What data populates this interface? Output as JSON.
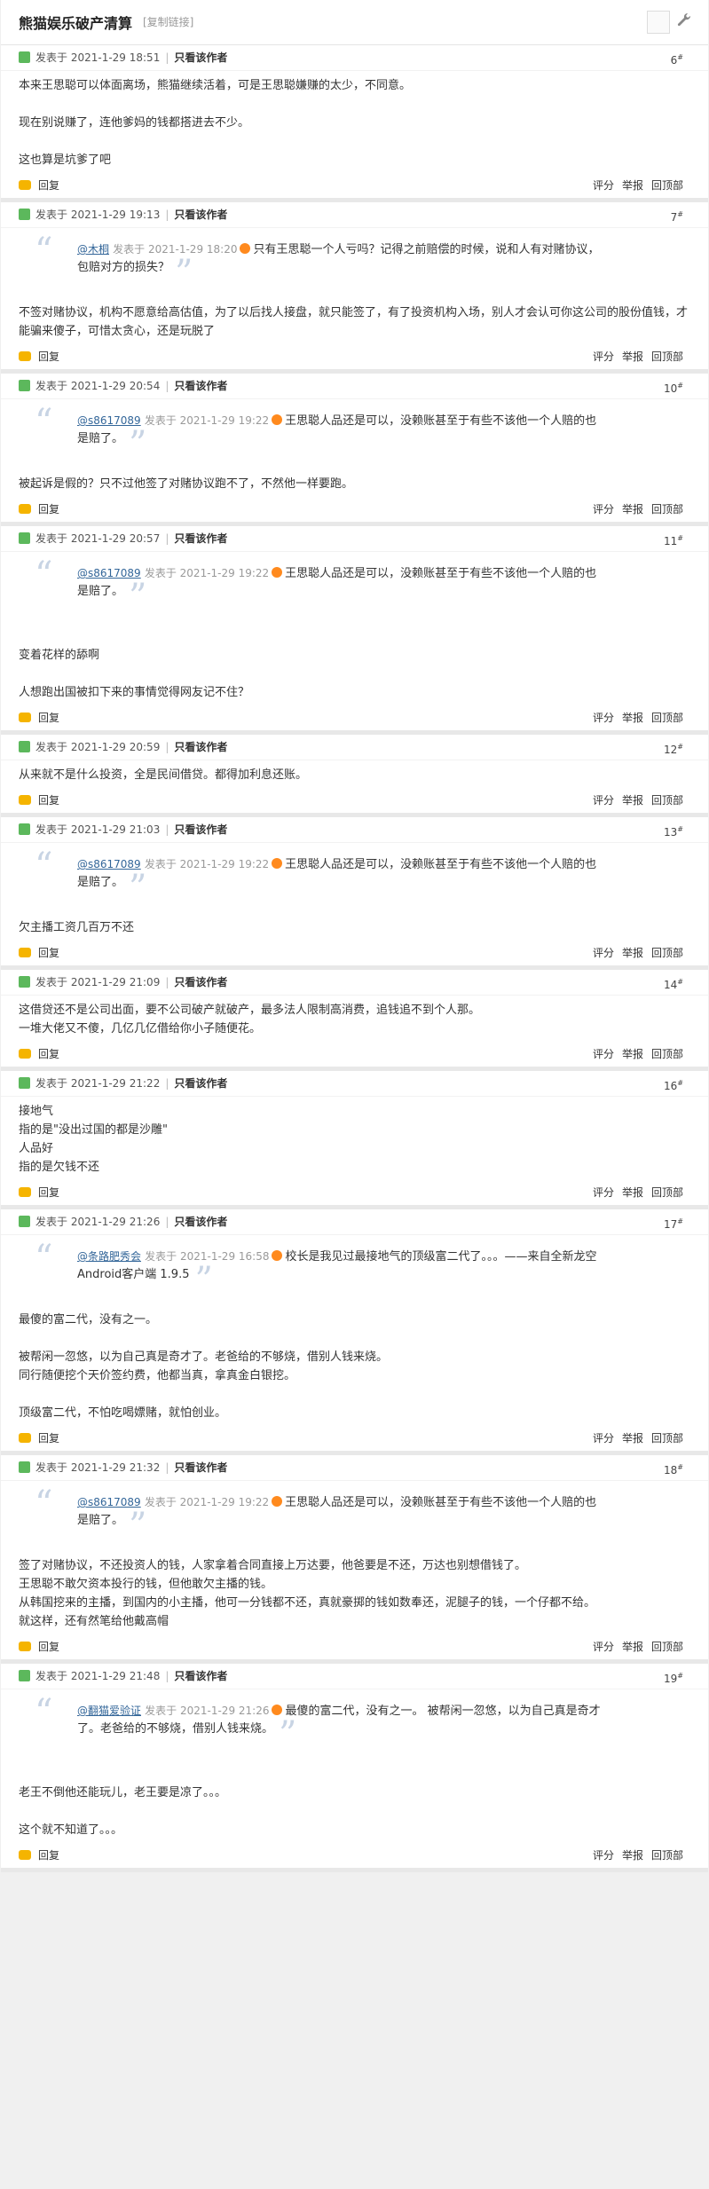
{
  "header": {
    "title": "熊猫娱乐破产清算",
    "copy_link": "[复制链接]",
    "wrench_icon": "wrench-icon"
  },
  "labels": {
    "posted_at": "发表于",
    "only_author": "只看该作者",
    "reply": "回复",
    "rate": "评分",
    "report": "举报",
    "back_top": "回顶部"
  },
  "posts": [
    {
      "floor": "6",
      "time": "2021-1-29 18:51",
      "lines": [
        "本来王思聪可以体面离场，熊猫继续活着，可是王思聪嫌赚的太少，不同意。",
        "",
        "现在别说赚了，连他爹妈的钱都搭进去不少。",
        "",
        "这也算是坑爹了吧"
      ]
    },
    {
      "floor": "7",
      "time": "2021-1-29 19:13",
      "quote": {
        "user": "@木桐",
        "when": "发表于 2021-1-29 18:20",
        "text": "只有王思聪一个人亏吗？记得之前赔偿的时候，说和人有对赌协议，包赔对方的损失？"
      },
      "lines": [
        "不签对赌协议，机构不愿意给高估值，为了以后找人接盘，就只能签了，有了投资机构入场，别人才会认可你这公司的股份值钱，才能骗来傻子，可惜太贪心，还是玩脱了"
      ]
    },
    {
      "floor": "10",
      "time": "2021-1-29 20:54",
      "quote": {
        "user": "@s8617089",
        "when": "发表于 2021-1-29 19:22",
        "text": "王思聪人品还是可以，没赖账甚至于有些不该他一个人赔的也是赔了。"
      },
      "lines": [
        "被起诉是假的？只不过他签了对赌协议跑不了，不然他一样要跑。"
      ]
    },
    {
      "floor": "11",
      "time": "2021-1-29 20:57",
      "quote": {
        "user": "@s8617089",
        "when": "发表于 2021-1-29 19:22",
        "text": "王思聪人品还是可以，没赖账甚至于有些不该他一个人赔的也是赔了。"
      },
      "lines": [
        "",
        "变着花样的舔啊",
        "",
        "人想跑出国被扣下来的事情觉得网友记不住？"
      ]
    },
    {
      "floor": "12",
      "time": "2021-1-29 20:59",
      "lines": [
        "从来就不是什么投资，全是民间借贷。都得加利息还账。"
      ]
    },
    {
      "floor": "13",
      "time": "2021-1-29 21:03",
      "quote": {
        "user": "@s8617089",
        "when": "发表于 2021-1-29 19:22",
        "text": "王思聪人品还是可以，没赖账甚至于有些不该他一个人赔的也是赔了。"
      },
      "lines": [
        "欠主播工资几百万不还"
      ]
    },
    {
      "floor": "14",
      "time": "2021-1-29 21:09",
      "lines": [
        "这借贷还不是公司出面，要不公司破产就破产，最多法人限制高消费，追钱追不到个人那。",
        "一堆大佬又不傻，几亿几亿借给你小子随便花。"
      ]
    },
    {
      "floor": "16",
      "time": "2021-1-29 21:22",
      "lines": [
        "接地气",
        "指的是\"没出过国的都是沙雕\"",
        "人品好",
        "指的是欠钱不还"
      ]
    },
    {
      "floor": "17",
      "time": "2021-1-29 21:26",
      "quote": {
        "user": "@条路肥秀会",
        "when": "发表于 2021-1-29 16:58",
        "text": "校长是我见过最接地气的顶级富二代了。。。——来自全新龙空Android客户端 1.9.5"
      },
      "lines": [
        "最傻的富二代，没有之一。",
        "",
        "被帮闲一忽悠，以为自己真是奇才了。老爸给的不够烧，借别人钱来烧。",
        "同行随便挖个天价签约费，他都当真，拿真金白银挖。",
        "",
        "顶级富二代，不怕吃喝嫖赌，就怕创业。"
      ]
    },
    {
      "floor": "18",
      "time": "2021-1-29 21:32",
      "quote": {
        "user": "@s8617089",
        "when": "发表于 2021-1-29 19:22",
        "text": "王思聪人品还是可以，没赖账甚至于有些不该他一个人赔的也是赔了。"
      },
      "lines": [
        "签了对赌协议，不还投资人的钱，人家拿着合同直接上万达要，他爸要是不还，万达也别想借钱了。",
        "王思聪不敢欠资本投行的钱，但他敢欠主播的钱。",
        "从韩国挖来的主播，到国内的小主播，他可一分钱都不还，真就豪掷的钱如数奉还，泥腿子的钱，一个仔都不给。",
        "就这样，还有然笔给他戴高帽"
      ]
    },
    {
      "floor": "19",
      "time": "2021-1-29 21:48",
      "quote": {
        "user": "@翻猫爱验证",
        "when": "发表于 2021-1-29 21:26",
        "text": "最傻的富二代，没有之一。 被帮闲一忽悠，以为自己真是奇才了。老爸给的不够烧，借别人钱来烧。"
      },
      "lines": [
        "",
        "老王不倒他还能玩儿，老王要是凉了。。。",
        "",
        "这个就不知道了。。。"
      ]
    }
  ]
}
